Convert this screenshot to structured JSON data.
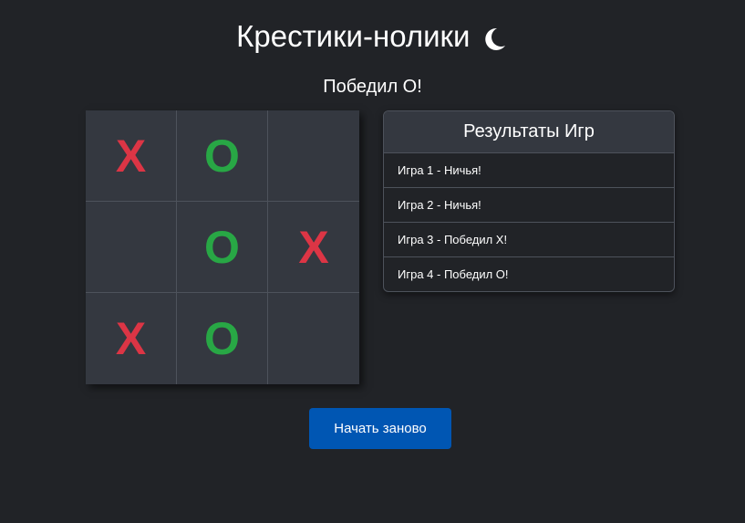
{
  "header": {
    "title": "Крестики-нолики",
    "theme_toggle_icon": "moon-icon"
  },
  "status": "Победил O!",
  "board": [
    [
      "X",
      "O",
      ""
    ],
    [
      "",
      "O",
      "X"
    ],
    [
      "X",
      "O",
      ""
    ]
  ],
  "results": {
    "title": "Результаты Игр",
    "items": [
      "Игра 1 - Ничья!",
      "Игра 2 - Ничья!",
      "Игра 3 - Победил X!",
      "Игра 4 - Победил O!"
    ]
  },
  "controls": {
    "restart_label": "Начать заново"
  },
  "colors": {
    "background": "#212327",
    "x": "#dc3545",
    "o": "#28a745",
    "button": "#0056b3"
  }
}
